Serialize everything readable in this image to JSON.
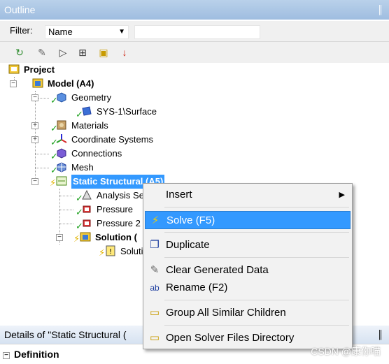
{
  "outline": {
    "title": "Outline",
    "pin": "║"
  },
  "filter": {
    "label": "Filter:",
    "selected": "Name",
    "text_value": ""
  },
  "toolbar": {
    "buttons": [
      {
        "icon": "refresh-icon",
        "glyph": "↻"
      },
      {
        "icon": "eraser-icon",
        "glyph": "✎"
      },
      {
        "icon": "collapse-arrow-icon",
        "glyph": "▷"
      },
      {
        "icon": "expand-all-icon",
        "glyph": "⊞"
      },
      {
        "icon": "folder-icon",
        "glyph": "▣"
      },
      {
        "icon": "sort-az-icon",
        "glyph": "↓"
      }
    ]
  },
  "tree": {
    "project": "Project",
    "model": "Model (A4)",
    "geometry": "Geometry",
    "surface": "SYS-1\\Surface",
    "materials": "Materials",
    "coordinate_systems": "Coordinate Systems",
    "connections": "Connections",
    "mesh": "Mesh",
    "static_structural": "Static Structural (A5)",
    "analysis_settings": "Analysis Se",
    "pressure": "Pressure",
    "pressure2": "Pressure 2",
    "solution": "Solution (",
    "solution_info": "Soluti"
  },
  "context_menu": {
    "items": [
      {
        "label": "Insert",
        "icon": "",
        "submenu": "▶"
      },
      {
        "label": "Solve (F5)",
        "icon": "⚡"
      },
      {
        "label": "Duplicate",
        "icon": "❐"
      },
      {
        "label": "Clear Generated Data",
        "icon": "✎"
      },
      {
        "label": "Rename (F2)",
        "icon": "ab"
      },
      {
        "label": "Group All Similar Children",
        "icon": "▭"
      },
      {
        "label": "Open Solver Files Directory",
        "icon": "▭"
      }
    ]
  },
  "details": {
    "title": "Details of \"Static Structural (",
    "pin": "║",
    "section": "Definition"
  },
  "watermark": "CSDN @康你喵",
  "colors": {
    "selection": "#3399ff",
    "title_bar": "#9fbde0",
    "check_green": "#1ea11e",
    "bolt_yellow": "#e2b400"
  }
}
